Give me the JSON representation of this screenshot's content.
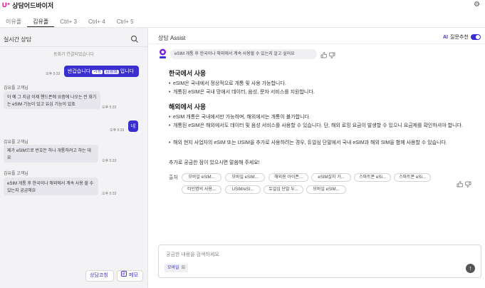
{
  "header": {
    "logo_mark": "U⁺",
    "title": "상담어드바이저"
  },
  "tabs": [
    {
      "label": "이유플"
    },
    {
      "label": "김유플"
    },
    {
      "label": "Ctrl+ 3"
    },
    {
      "label": "Ctrl+ 4"
    },
    {
      "label": "Ctrl+ 5"
    }
  ],
  "left": {
    "title": "실시간 상담",
    "system_message": "동화가 연결되었습니다",
    "agent_msg_1": {
      "text_prefix": "반갑습니다",
      "chip1": "이용",
      "chip2": "김영희",
      "text_suffix": "입니다",
      "time": "오후 5:33"
    },
    "cust1": {
      "name": "김유플 고객님",
      "text": "아 예 그 지금 이제 핸드폰에 요즘에 나오는 전 화기는 eSIM 기능이 있고 유심 기능이 있죠",
      "time": "오후 5:33"
    },
    "agent_msg_2": {
      "text": "네",
      "time": "오후 5:33"
    },
    "cust2": {
      "name": "김유플 고객님",
      "text": "제가 eSIM으로 번호든 하나 개통하려고 하는 데요",
      "time": "오후 5:33"
    },
    "cust3": {
      "name": "김유플 고객님",
      "text": "eSIM 개통 후 한국이나 해외에서 계속 사용 할 수 있는지 궁금해요",
      "time": "오후 5:33"
    },
    "btn_consult": "상담코칭",
    "btn_memo": "메모"
  },
  "right": {
    "title": "상담 Assist",
    "ai_label": "AI",
    "toggle_label": "질문추천",
    "question": "eSIM 개통 후 한국이나 해외에서 계속 사용할 수 있는지 알고 싶어요",
    "section1_title": "한국에서 사용",
    "section1_bullets": [
      "eSIM은 국내에서 정상적으로 개통 및 사용 가능합니다.",
      "개통된 eSIM은 국내 망에서 데이터, 음성, 문자 서비스를 지원합니다."
    ],
    "section2_title": "해외에서 사용",
    "section2_bullets": [
      "eSIM 개통은 국내에서만 가능하며, 해외에서는 개통이 불가합니다.",
      "개통된 eSIM은 해외에서도 데이터 및 음성 서비스를 사용할 수 있습니다. 단, 해외 로밍 요금이 발생할 수 있으니 요금제를 확인하셔야 합니다.",
      "해외 현지 사업자의 eSIM 또는 USIM을 추가로 사용하려는 경우, 듀얼심 단말에서 국내 eSIM과 해외 SIM을 함께 사용할 수 있습니다."
    ],
    "closing": "추가로 궁금한 점이 있으시면 말씀해 주세요!",
    "sources_label": "출처",
    "sources_row1": [
      "모바일 eSIM...",
      "모바일 eSIM...",
      "해외용 아이폰...",
      "eSIM설치 가...",
      "스마트폰 eSI...",
      "스마트폰 eSI..."
    ],
    "sources_row2": [
      "타인명의 사용...",
      "USIM/eSI...",
      "듀얼심 단말 두...",
      "모바일 eSIM..."
    ],
    "input_placeholder": "궁금한 내용을 검색하세요",
    "input_tag": "모바일",
    "input_tag_x": "☒",
    "send_glyph": "↑"
  },
  "colors": {
    "accent": "#3a2fd1",
    "brand": "#e6007e"
  }
}
